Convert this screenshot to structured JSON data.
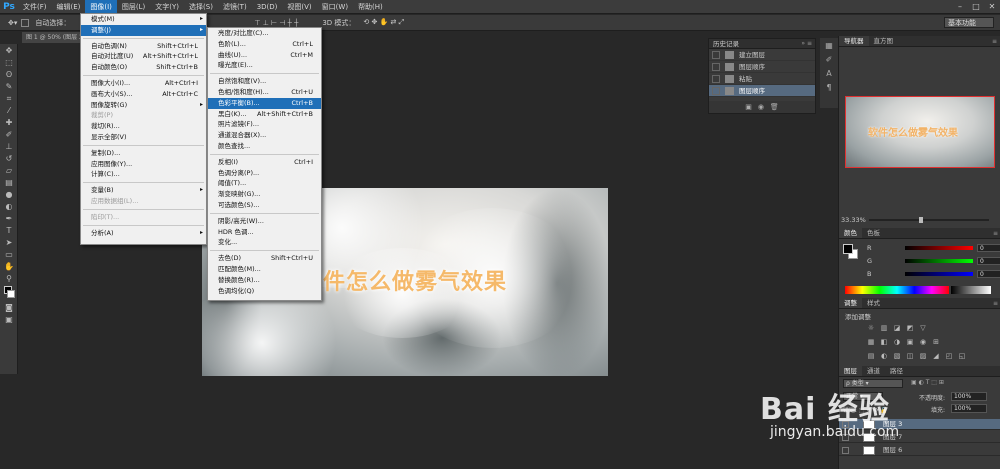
{
  "menubar": {
    "logo": "Ps",
    "items": [
      "文件(F)",
      "编辑(E)",
      "图像(I)",
      "图层(L)",
      "文字(Y)",
      "选择(S)",
      "滤镜(T)",
      "3D(D)",
      "视图(V)",
      "窗口(W)",
      "帮助(H)"
    ],
    "active_index": 2,
    "window_controls": [
      "–",
      "□",
      "✕"
    ]
  },
  "optbar": {
    "auto_select": "自动选择：",
    "mode_3d": "3D 模式：",
    "workspace": "基本功能"
  },
  "doc_tab": "图 1 @ 50% (图层 2, RGB/8)",
  "image_menu": {
    "rows": [
      {
        "label": "模式(M)",
        "shortcut": "",
        "submenu": true
      },
      {
        "label": "调整(J)",
        "shortcut": "",
        "submenu": true,
        "highlight": true
      },
      {
        "sep": true
      },
      {
        "label": "自动色调(N)",
        "shortcut": "Shift+Ctrl+L"
      },
      {
        "label": "自动对比度(U)",
        "shortcut": "Alt+Shift+Ctrl+L"
      },
      {
        "label": "自动颜色(O)",
        "shortcut": "Shift+Ctrl+B"
      },
      {
        "sep": true
      },
      {
        "label": "图像大小(I)...",
        "shortcut": "Alt+Ctrl+I"
      },
      {
        "label": "画布大小(S)...",
        "shortcut": "Alt+Ctrl+C"
      },
      {
        "label": "图像旋转(G)",
        "shortcut": "",
        "submenu": true
      },
      {
        "label": "裁剪(P)",
        "shortcut": "",
        "disabled": true
      },
      {
        "label": "裁切(R)...",
        "shortcut": ""
      },
      {
        "label": "显示全部(V)",
        "shortcut": ""
      },
      {
        "sep": true
      },
      {
        "label": "复制(D)...",
        "shortcut": ""
      },
      {
        "label": "应用图像(Y)...",
        "shortcut": ""
      },
      {
        "label": "计算(C)...",
        "shortcut": ""
      },
      {
        "sep": true
      },
      {
        "label": "变量(B)",
        "shortcut": "",
        "submenu": true
      },
      {
        "label": "应用数据组(L)...",
        "shortcut": "",
        "disabled": true
      },
      {
        "sep": true
      },
      {
        "label": "陷印(T)...",
        "shortcut": "",
        "disabled": true
      },
      {
        "sep": true
      },
      {
        "label": "分析(A)",
        "shortcut": "",
        "submenu": true
      }
    ]
  },
  "adjust_menu": {
    "rows": [
      {
        "label": "亮度/对比度(C)...",
        "shortcut": ""
      },
      {
        "label": "色阶(L)...",
        "shortcut": "Ctrl+L"
      },
      {
        "label": "曲线(U)...",
        "shortcut": "Ctrl+M"
      },
      {
        "label": "曝光度(E)...",
        "shortcut": ""
      },
      {
        "sep": true
      },
      {
        "label": "自然饱和度(V)...",
        "shortcut": ""
      },
      {
        "label": "色相/饱和度(H)...",
        "shortcut": "Ctrl+U"
      },
      {
        "label": "色彩平衡(B)...",
        "shortcut": "Ctrl+B",
        "highlight": true
      },
      {
        "label": "黑白(K)...",
        "shortcut": "Alt+Shift+Ctrl+B"
      },
      {
        "label": "照片滤镜(F)...",
        "shortcut": ""
      },
      {
        "label": "通道混合器(X)...",
        "shortcut": ""
      },
      {
        "label": "颜色查找...",
        "shortcut": ""
      },
      {
        "sep": true
      },
      {
        "label": "反相(I)",
        "shortcut": "Ctrl+I"
      },
      {
        "label": "色调分离(P)...",
        "shortcut": ""
      },
      {
        "label": "阈值(T)...",
        "shortcut": ""
      },
      {
        "label": "渐变映射(G)...",
        "shortcut": ""
      },
      {
        "label": "可选颜色(S)...",
        "shortcut": ""
      },
      {
        "sep": true
      },
      {
        "label": "阴影/高光(W)...",
        "shortcut": ""
      },
      {
        "label": "HDR 色调...",
        "shortcut": ""
      },
      {
        "label": "变化...",
        "shortcut": ""
      },
      {
        "sep": true
      },
      {
        "label": "去色(D)",
        "shortcut": "Shift+Ctrl+U"
      },
      {
        "label": "匹配颜色(M)...",
        "shortcut": ""
      },
      {
        "label": "替换颜色(R)...",
        "shortcut": ""
      },
      {
        "label": "色调均化(Q)",
        "shortcut": ""
      }
    ]
  },
  "canvas": {
    "title": "软件怎么做雾气效果"
  },
  "history": {
    "title": "历史记录",
    "items": [
      "建立图层",
      "图层顺序",
      "粘贴",
      "图层顺序"
    ],
    "selected_index": 3
  },
  "navigator": {
    "tabs": [
      "导航器",
      "直方图"
    ],
    "preview_title": "软件怎么做雾气效果",
    "zoom": "33.33%"
  },
  "color": {
    "tabs": [
      "颜色",
      "色板"
    ],
    "channels": [
      {
        "name": "R",
        "value": "0",
        "bar": "linear-gradient(90deg,#000,#ff0000)"
      },
      {
        "name": "G",
        "value": "0",
        "bar": "linear-gradient(90deg,#000,#00ff00)"
      },
      {
        "name": "B",
        "value": "0",
        "bar": "linear-gradient(90deg,#000,#0000ff)"
      }
    ]
  },
  "adjustments": {
    "tabs": [
      "调整",
      "样式"
    ],
    "add_label": "添加调整"
  },
  "layers": {
    "tabs": [
      "图层",
      "通道",
      "路径"
    ],
    "opacity_label": "不透明度:",
    "opacity_value": "100%",
    "fill_label": "填充:",
    "fill_value": "100%",
    "rows": [
      {
        "name": "图层 3",
        "selected": true
      },
      {
        "name": "图层 7",
        "selected": false
      },
      {
        "name": "图层 6",
        "selected": false
      }
    ]
  },
  "watermark": {
    "logo": "Bai 经验",
    "url": "jingyan.baidu.com"
  }
}
